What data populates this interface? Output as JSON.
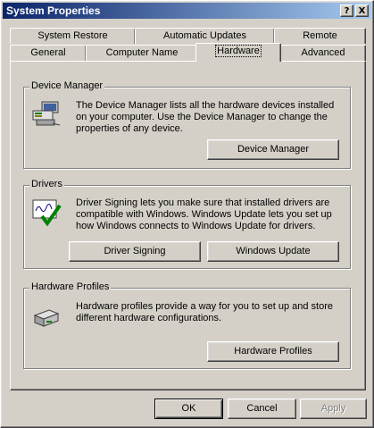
{
  "window": {
    "title": "System Properties",
    "help_button": "?",
    "close_button": "X"
  },
  "tabs": {
    "back_row": [
      "System Restore",
      "Automatic Updates",
      "Remote"
    ],
    "front_row": [
      "General",
      "Computer Name",
      "Hardware",
      "Advanced"
    ],
    "active": "Hardware"
  },
  "device_manager": {
    "title": "Device Manager",
    "description": "The Device Manager lists all the hardware devices installed on your computer. Use the Device Manager to change the properties of any device.",
    "button": "Device Manager",
    "icon": "device-manager-icon"
  },
  "drivers": {
    "title": "Drivers",
    "description": "Driver Signing lets you make sure that installed drivers are compatible with Windows. Windows Update lets you set up how Windows connects to Windows Update for drivers.",
    "driver_signing_button": "Driver Signing",
    "windows_update_button": "Windows Update",
    "icon": "driver-signing-icon"
  },
  "hardware_profiles": {
    "title": "Hardware Profiles",
    "description": "Hardware profiles provide a way for you to set up and store different hardware configurations.",
    "button": "Hardware Profiles",
    "icon": "hardware-profiles-icon"
  },
  "footer": {
    "ok": "OK",
    "cancel": "Cancel",
    "apply": "Apply"
  }
}
